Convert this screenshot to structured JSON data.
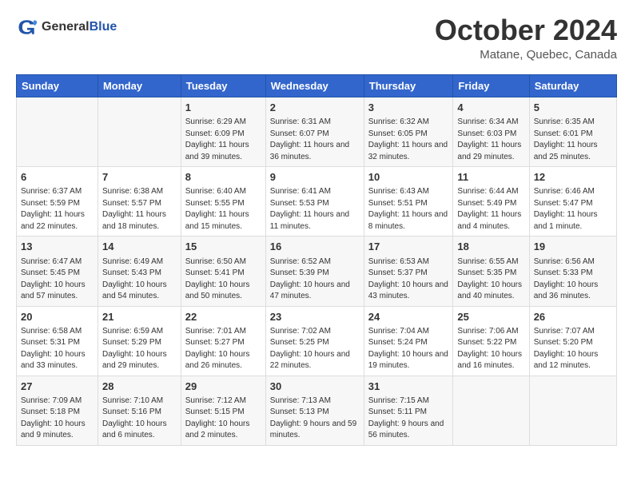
{
  "header": {
    "logo_general": "General",
    "logo_blue": "Blue",
    "month": "October 2024",
    "location": "Matane, Quebec, Canada"
  },
  "weekdays": [
    "Sunday",
    "Monday",
    "Tuesday",
    "Wednesday",
    "Thursday",
    "Friday",
    "Saturday"
  ],
  "weeks": [
    [
      {
        "day": "",
        "info": ""
      },
      {
        "day": "",
        "info": ""
      },
      {
        "day": "1",
        "info": "Sunrise: 6:29 AM\nSunset: 6:09 PM\nDaylight: 11 hours and 39 minutes."
      },
      {
        "day": "2",
        "info": "Sunrise: 6:31 AM\nSunset: 6:07 PM\nDaylight: 11 hours and 36 minutes."
      },
      {
        "day": "3",
        "info": "Sunrise: 6:32 AM\nSunset: 6:05 PM\nDaylight: 11 hours and 32 minutes."
      },
      {
        "day": "4",
        "info": "Sunrise: 6:34 AM\nSunset: 6:03 PM\nDaylight: 11 hours and 29 minutes."
      },
      {
        "day": "5",
        "info": "Sunrise: 6:35 AM\nSunset: 6:01 PM\nDaylight: 11 hours and 25 minutes."
      }
    ],
    [
      {
        "day": "6",
        "info": "Sunrise: 6:37 AM\nSunset: 5:59 PM\nDaylight: 11 hours and 22 minutes."
      },
      {
        "day": "7",
        "info": "Sunrise: 6:38 AM\nSunset: 5:57 PM\nDaylight: 11 hours and 18 minutes."
      },
      {
        "day": "8",
        "info": "Sunrise: 6:40 AM\nSunset: 5:55 PM\nDaylight: 11 hours and 15 minutes."
      },
      {
        "day": "9",
        "info": "Sunrise: 6:41 AM\nSunset: 5:53 PM\nDaylight: 11 hours and 11 minutes."
      },
      {
        "day": "10",
        "info": "Sunrise: 6:43 AM\nSunset: 5:51 PM\nDaylight: 11 hours and 8 minutes."
      },
      {
        "day": "11",
        "info": "Sunrise: 6:44 AM\nSunset: 5:49 PM\nDaylight: 11 hours and 4 minutes."
      },
      {
        "day": "12",
        "info": "Sunrise: 6:46 AM\nSunset: 5:47 PM\nDaylight: 11 hours and 1 minute."
      }
    ],
    [
      {
        "day": "13",
        "info": "Sunrise: 6:47 AM\nSunset: 5:45 PM\nDaylight: 10 hours and 57 minutes."
      },
      {
        "day": "14",
        "info": "Sunrise: 6:49 AM\nSunset: 5:43 PM\nDaylight: 10 hours and 54 minutes."
      },
      {
        "day": "15",
        "info": "Sunrise: 6:50 AM\nSunset: 5:41 PM\nDaylight: 10 hours and 50 minutes."
      },
      {
        "day": "16",
        "info": "Sunrise: 6:52 AM\nSunset: 5:39 PM\nDaylight: 10 hours and 47 minutes."
      },
      {
        "day": "17",
        "info": "Sunrise: 6:53 AM\nSunset: 5:37 PM\nDaylight: 10 hours and 43 minutes."
      },
      {
        "day": "18",
        "info": "Sunrise: 6:55 AM\nSunset: 5:35 PM\nDaylight: 10 hours and 40 minutes."
      },
      {
        "day": "19",
        "info": "Sunrise: 6:56 AM\nSunset: 5:33 PM\nDaylight: 10 hours and 36 minutes."
      }
    ],
    [
      {
        "day": "20",
        "info": "Sunrise: 6:58 AM\nSunset: 5:31 PM\nDaylight: 10 hours and 33 minutes."
      },
      {
        "day": "21",
        "info": "Sunrise: 6:59 AM\nSunset: 5:29 PM\nDaylight: 10 hours and 29 minutes."
      },
      {
        "day": "22",
        "info": "Sunrise: 7:01 AM\nSunset: 5:27 PM\nDaylight: 10 hours and 26 minutes."
      },
      {
        "day": "23",
        "info": "Sunrise: 7:02 AM\nSunset: 5:25 PM\nDaylight: 10 hours and 22 minutes."
      },
      {
        "day": "24",
        "info": "Sunrise: 7:04 AM\nSunset: 5:24 PM\nDaylight: 10 hours and 19 minutes."
      },
      {
        "day": "25",
        "info": "Sunrise: 7:06 AM\nSunset: 5:22 PM\nDaylight: 10 hours and 16 minutes."
      },
      {
        "day": "26",
        "info": "Sunrise: 7:07 AM\nSunset: 5:20 PM\nDaylight: 10 hours and 12 minutes."
      }
    ],
    [
      {
        "day": "27",
        "info": "Sunrise: 7:09 AM\nSunset: 5:18 PM\nDaylight: 10 hours and 9 minutes."
      },
      {
        "day": "28",
        "info": "Sunrise: 7:10 AM\nSunset: 5:16 PM\nDaylight: 10 hours and 6 minutes."
      },
      {
        "day": "29",
        "info": "Sunrise: 7:12 AM\nSunset: 5:15 PM\nDaylight: 10 hours and 2 minutes."
      },
      {
        "day": "30",
        "info": "Sunrise: 7:13 AM\nSunset: 5:13 PM\nDaylight: 9 hours and 59 minutes."
      },
      {
        "day": "31",
        "info": "Sunrise: 7:15 AM\nSunset: 5:11 PM\nDaylight: 9 hours and 56 minutes."
      },
      {
        "day": "",
        "info": ""
      },
      {
        "day": "",
        "info": ""
      }
    ]
  ]
}
